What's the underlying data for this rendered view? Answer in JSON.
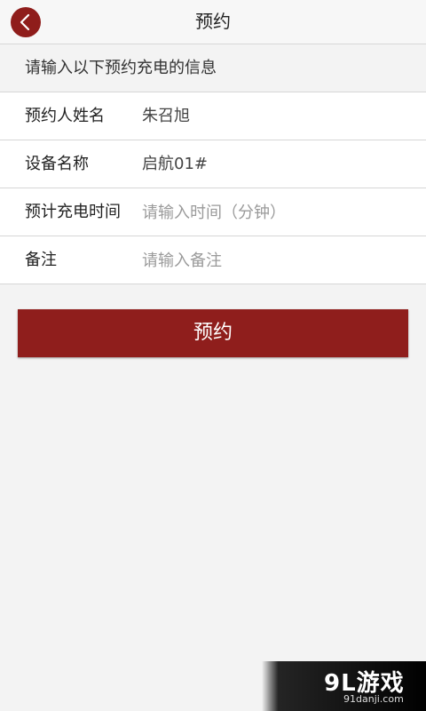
{
  "header": {
    "title": "预约",
    "back_icon": "chevron-left-icon",
    "accent_color": "#8f1d1b"
  },
  "form": {
    "section_title": "请输入以下预约充电的信息",
    "rows": [
      {
        "label": "预约人姓名",
        "value": "朱召旭"
      },
      {
        "label": "设备名称",
        "value": "启航01#"
      },
      {
        "label": "预计充电时间",
        "placeholder": "请输入时间（分钟）"
      },
      {
        "label": "备注",
        "placeholder": "请输入备注"
      }
    ],
    "submit_label": "预约"
  },
  "watermark": {
    "logo": "9L游戏",
    "url": "91danji.com"
  }
}
